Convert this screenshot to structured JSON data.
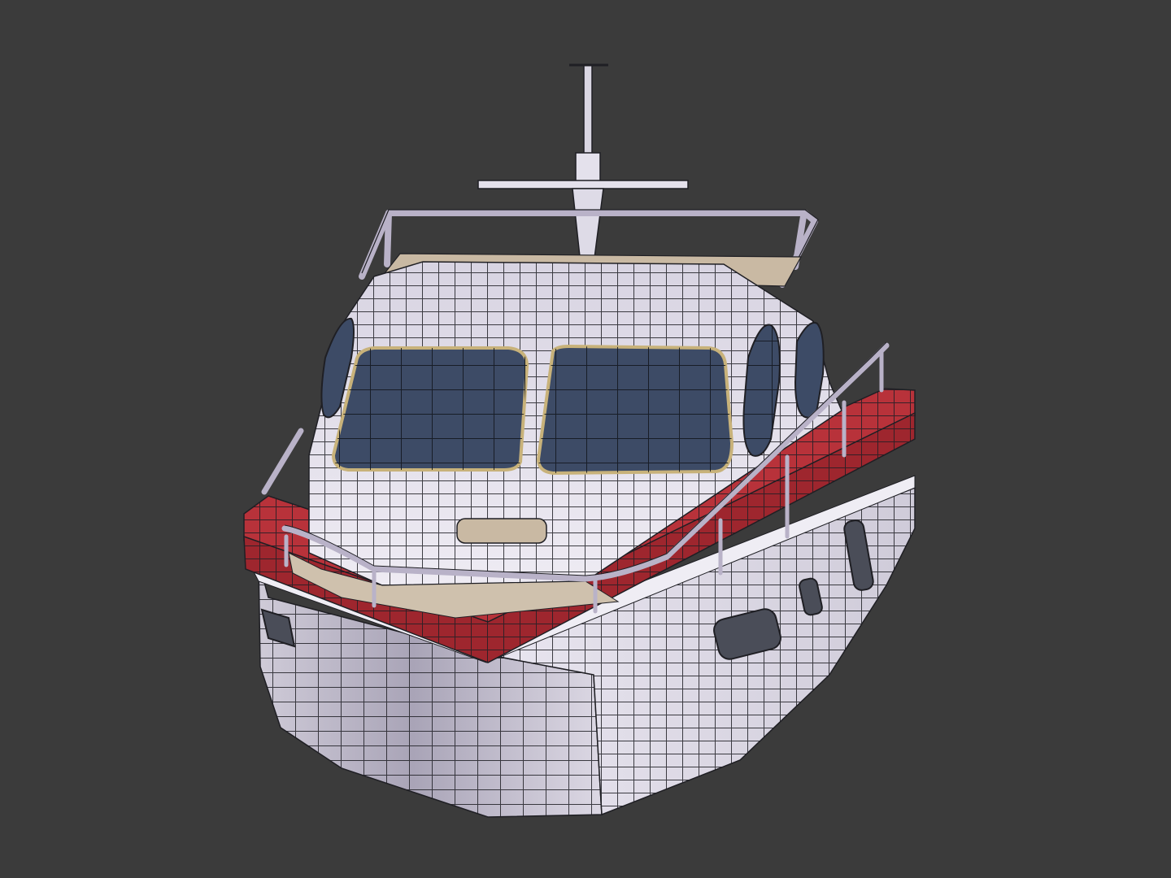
{
  "viewport": {
    "background": "#3b3b3b"
  },
  "model": {
    "subject": "boat-wireframe-render",
    "colors": {
      "hull": "#e6e3ee",
      "hull_shadow": "#b9b4c6",
      "stripe": "#b8323a",
      "stripe_dark": "#8d2128",
      "deck": "#c9b9a3",
      "glass": "#3d4b66",
      "rail": "#b9b2c8",
      "wire": "#1f1f24"
    }
  }
}
